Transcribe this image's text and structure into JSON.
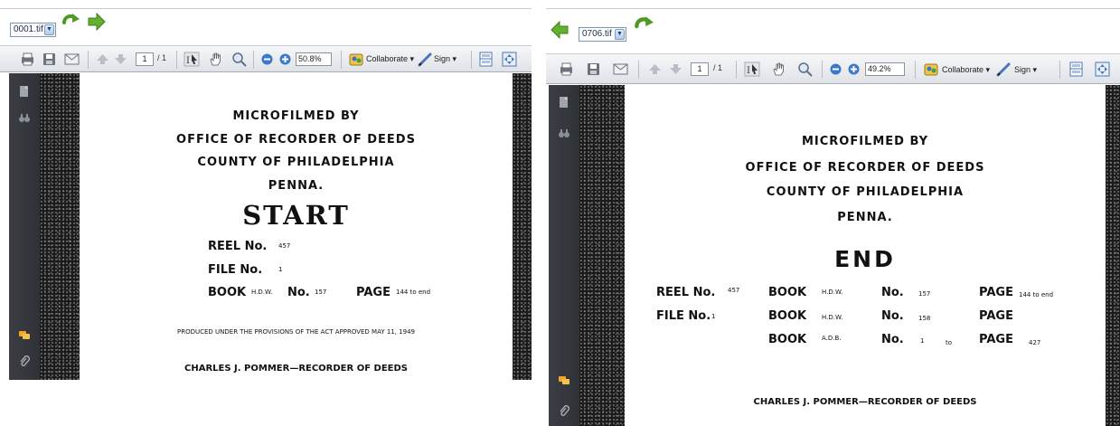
{
  "left": {
    "file_select": "0001.tif",
    "page_current": "1",
    "page_total": "/ 1",
    "zoom": "50.8%",
    "collaborate": "Collaborate ▾",
    "sign": "Sign ▾",
    "doc": {
      "line1": "MICROFILMED BY",
      "line2": "OFFICE OF RECORDER OF DEEDS",
      "line3": "COUNTY OF PHILADELPHIA",
      "line4": "PENNA.",
      "heading": "START",
      "reel_label": "REEL No.",
      "reel_value": "457",
      "file_label": "FILE  No.",
      "file_value": "1",
      "book_label": "BOOK",
      "book_value": "H.D.W.",
      "book_no_label": "No.",
      "book_no_value": "157",
      "page_label": "PAGE",
      "page_value": "144 to end",
      "provisions": "PRODUCED UNDER THE PROVISIONS OF THE ACT APPROVED MAY 11, 1949",
      "recorder": "CHARLES J. POMMER—RECORDER OF DEEDS"
    }
  },
  "right": {
    "file_select": "0706.tif",
    "page_current": "1",
    "page_total": "/ 1",
    "zoom": "49.2%",
    "collaborate": "Collaborate ▾",
    "sign": "Sign ▾",
    "doc": {
      "line1": "MICROFILMED BY",
      "line2": "OFFICE OF RECORDER OF DEEDS",
      "line3": "COUNTY OF PHILADELPHIA",
      "line4": "PENNA.",
      "heading": "END",
      "rows": [
        {
          "c1_label": "REEL  No.",
          "c1_value": "457",
          "book": "BOOK",
          "book_value": "H.D.W.",
          "no": "No.",
          "no_value": "157",
          "page": "PAGE",
          "page_value": "144 to end"
        },
        {
          "c1_label": "FILE   No.",
          "c1_value": "1",
          "book": "BOOK",
          "book_value": "H.D.W.",
          "no": "No.",
          "no_value": "158",
          "page": "PAGE",
          "page_value": ""
        },
        {
          "c1_label": "",
          "c1_value": "",
          "book": "BOOK",
          "book_value": "A.D.B.",
          "no": "No.",
          "no_value": "1",
          "to": "to",
          "page": "PAGE",
          "page_value": "427"
        }
      ],
      "recorder": "CHARLES J. POMMER—RECORDER OF DEEDS"
    }
  },
  "icons": [
    "refresh-arrow-icon",
    "next-arrow-icon",
    "prev-arrow-icon",
    "print-icon",
    "save-icon",
    "email-icon",
    "page-up-icon",
    "page-down-icon",
    "select-tool-icon",
    "hand-tool-icon",
    "marquee-zoom-icon",
    "zoom-out-icon",
    "zoom-in-icon",
    "collaborate-icon",
    "sign-icon",
    "fit-page-icon",
    "full-screen-icon",
    "pages-panel-icon",
    "search-panel-icon",
    "comments-icon",
    "attachments-icon"
  ],
  "colors": {
    "accent_green": "#5aa52a",
    "toolbar": "#e8eaee",
    "sidebar": "#34373c",
    "select_border": "#7a96b6"
  }
}
